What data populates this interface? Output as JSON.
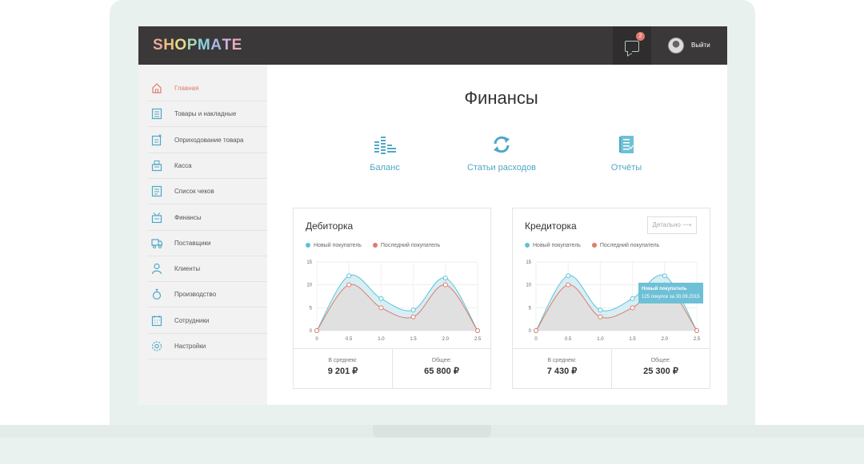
{
  "app": {
    "logo_letters": [
      "S",
      "H",
      "O",
      "P",
      "M",
      "A",
      "T",
      "E"
    ],
    "logo_colors": [
      "#e9a89c",
      "#eec07f",
      "#e9d98a",
      "#a8d7b5",
      "#8fcfe0",
      "#a9b8e0",
      "#d0b2dc",
      "#e9a9c0"
    ],
    "message_count": "2",
    "logout_label": "Выйти"
  },
  "colors": {
    "accent": "#e07a6c",
    "link": "#4ea8c6",
    "series_new": "#5fc2d6",
    "series_last": "#e07a6c",
    "topbar": "#3a3838"
  },
  "sidebar": {
    "items": [
      {
        "label": "Главная",
        "icon": "home-icon",
        "active": true
      },
      {
        "label": "Товары и накладные",
        "icon": "list-icon",
        "active": false
      },
      {
        "label": "Оприходование товара",
        "icon": "add-document-icon",
        "active": false
      },
      {
        "label": "Касса",
        "icon": "cash-register-icon",
        "active": false
      },
      {
        "label": "Список чеков",
        "icon": "receipt-list-icon",
        "active": false
      },
      {
        "label": "Финансы",
        "icon": "finance-icon",
        "active": false
      },
      {
        "label": "Поставщики",
        "icon": "truck-icon",
        "active": false
      },
      {
        "label": "Клиенты",
        "icon": "user-icon",
        "active": false
      },
      {
        "label": "Производство",
        "icon": "flask-icon",
        "active": false
      },
      {
        "label": "Сотрудники",
        "icon": "calendar-icon",
        "active": false
      },
      {
        "label": "Настройки",
        "icon": "gear-icon",
        "active": false
      }
    ]
  },
  "main": {
    "title": "Финансы",
    "quick_links": [
      {
        "label": "Баланс",
        "icon": "balance-chart-icon"
      },
      {
        "label": "Статьи расходов",
        "icon": "refresh-icon"
      },
      {
        "label": "Отчёты",
        "icon": "report-icon"
      }
    ]
  },
  "cards": [
    {
      "title": "Дебиторка",
      "legend": [
        "Новый покупатель",
        "Последний покупатель"
      ],
      "avg_label": "В среднем:",
      "avg_value": "9 201 ₽",
      "total_label": "Общее:",
      "total_value": "65 800 ₽"
    },
    {
      "title": "Кредиторка",
      "legend": [
        "Новый покупатель",
        "Последний покупатель"
      ],
      "detail_button": "Детально ⟶",
      "tooltip_title": "Новый покупатель",
      "tooltip_text": "125 покупок за 30.09.2015",
      "avg_label": "В среднем:",
      "avg_value": "7 430 ₽",
      "total_label": "Общее:",
      "total_value": "25 300 ₽"
    }
  ],
  "chart_data": [
    {
      "type": "area",
      "title": "Дебиторка",
      "x": [
        0,
        0.5,
        1.0,
        1.5,
        2.0,
        2.5
      ],
      "x_tick_labels": [
        "0",
        "0.5",
        "1.0",
        "1.5",
        "2.0",
        "2.5"
      ],
      "y_ticks": [
        0,
        5,
        10,
        15
      ],
      "ylim": [
        0,
        15
      ],
      "xlim": [
        0,
        2.5
      ],
      "grid": true,
      "legend_position": "top-left",
      "series": [
        {
          "name": "Новый покупатель",
          "values": [
            0,
            12,
            7,
            4.5,
            11.5,
            0
          ]
        },
        {
          "name": "Последний покупатель",
          "values": [
            0,
            10,
            5,
            3,
            10,
            0
          ]
        }
      ]
    },
    {
      "type": "area",
      "title": "Кредиторка",
      "x": [
        0,
        0.5,
        1.0,
        1.5,
        2.0,
        2.5
      ],
      "x_tick_labels": [
        "0",
        "0.5",
        "1.0",
        "1.5",
        "2.0",
        "2.5"
      ],
      "y_ticks": [
        0,
        5,
        10,
        15
      ],
      "ylim": [
        0,
        15
      ],
      "xlim": [
        0,
        2.5
      ],
      "grid": true,
      "legend_position": "top-left",
      "series": [
        {
          "name": "Новый покупатель",
          "values": [
            0,
            12,
            4.5,
            7,
            12,
            0
          ]
        },
        {
          "name": "Последний покупатель",
          "values": [
            0,
            10,
            3,
            5,
            10,
            0
          ]
        }
      ]
    }
  ]
}
